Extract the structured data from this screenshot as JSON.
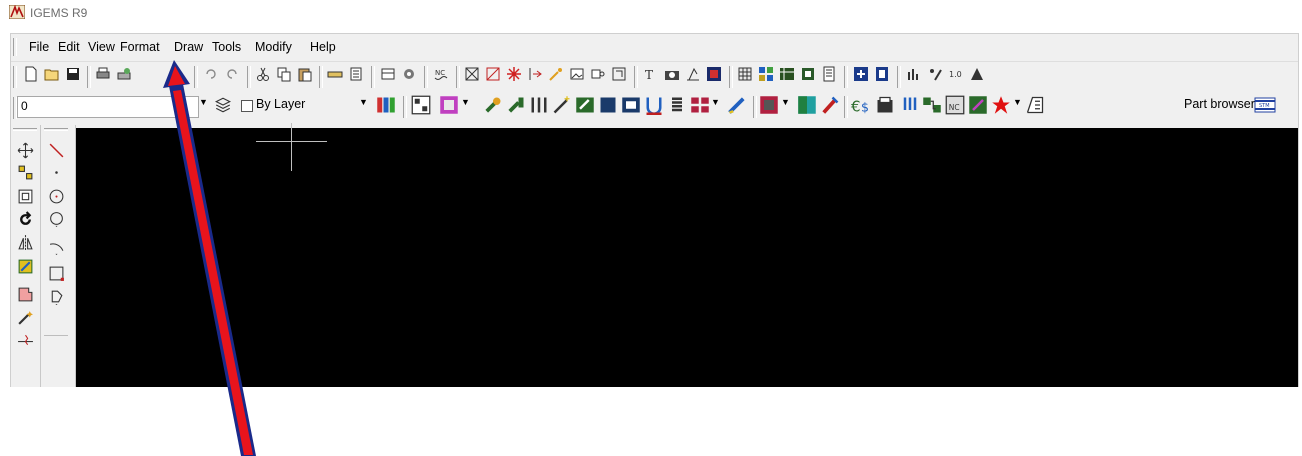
{
  "window": {
    "title": "IGEMS R9",
    "app_icon": "igems-app-icon"
  },
  "menu": {
    "items": [
      "File",
      "Edit",
      "View",
      "Format",
      "Draw",
      "Tools",
      "Modify",
      "Help"
    ]
  },
  "layer": {
    "current": "0"
  },
  "linetype": {
    "label": "By Layer"
  },
  "part_browser": {
    "label": "Part browser"
  },
  "canvas": {
    "background": "#000000",
    "crosshair_color": "#bfbfbf"
  },
  "annotation": {
    "arrow_color": "#e8141c",
    "arrow_outline": "#1a2a8a",
    "points_to": "Format"
  },
  "toolbar": {
    "standard": [
      "new-icon",
      "open-icon",
      "save-icon",
      "print-icon",
      "plot-icon",
      "undo-icon",
      "redo-icon",
      "cut-icon",
      "copy-icon",
      "paste-icon",
      "measure-icon",
      "properties-icon",
      "layout-icon",
      "settings-icon",
      "nc-icon",
      "trim-icon",
      "extend-icon",
      "explode-icon",
      "offset-icon",
      "trace-icon",
      "image-icon",
      "view-icon",
      "frame-icon",
      "text-icon",
      "camera-icon",
      "dimension-icon",
      "picture-icon",
      "grid-icon",
      "nest-icon",
      "table-icon",
      "part-icon",
      "report-icon",
      "add-icon",
      "page-icon",
      "stats-icon",
      "cut-order-icon",
      "sequence-icon",
      "end-icon"
    ]
  }
}
